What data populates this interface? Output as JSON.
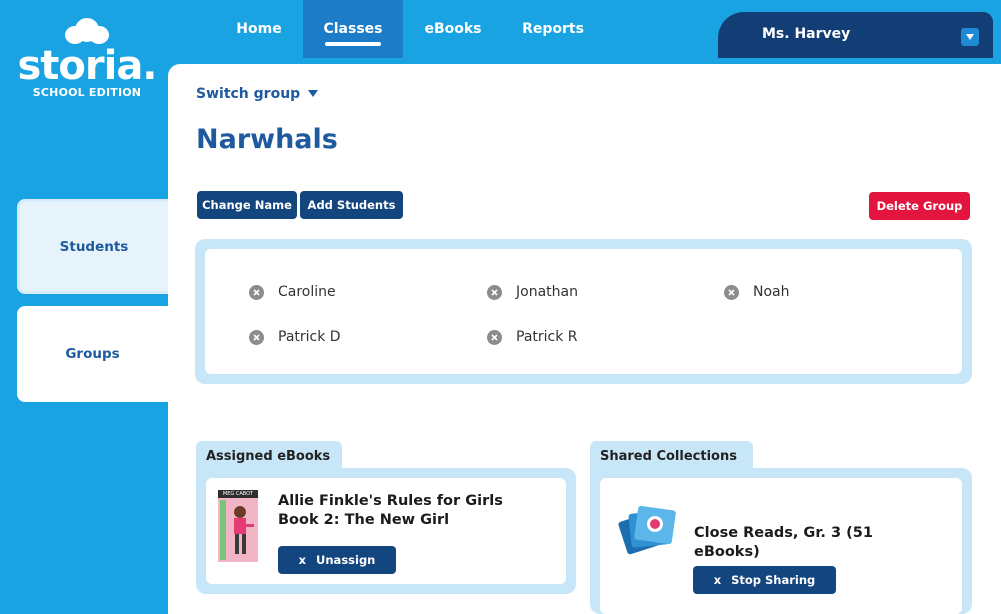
{
  "logo": {
    "brand": "storia.",
    "edition": "SCHOOL EDITION"
  },
  "nav": {
    "items": [
      "Home",
      "Classes",
      "eBooks",
      "Reports"
    ],
    "active": "Classes"
  },
  "user": {
    "name": "Ms. Harvey",
    "dropdown_icon": "chevron-down-icon"
  },
  "sidebar": {
    "items": [
      {
        "label": "Students",
        "selected": false
      },
      {
        "label": "Groups",
        "selected": true
      }
    ]
  },
  "group": {
    "switch_label": "Switch group",
    "name": "Narwhals",
    "buttons": {
      "change_name": "Change Name",
      "add_students": "Add Students",
      "delete_group": "Delete Group"
    },
    "students": [
      "Caroline",
      "Jonathan",
      "Noah",
      "Patrick D",
      "Patrick R"
    ]
  },
  "assigned": {
    "tab_label": "Assigned eBooks",
    "book": {
      "cover_author": "MEG CABOT",
      "title": "Allie Finkle's Rules for Girls Book 2: The New Girl",
      "button_icon": "x",
      "button_label": "Unassign"
    }
  },
  "shared": {
    "tab_label": "Shared Collections",
    "collection": {
      "title": "Close Reads, Gr. 3 (51 eBooks)",
      "button_icon": "x",
      "button_label": "Stop Sharing"
    }
  },
  "colors": {
    "background": "#1aa3e3",
    "nav_active": "#1d7cc8",
    "dark_button": "#13457f",
    "danger": "#e3153f",
    "panel": "#c7e6f8",
    "heading": "#1f5a9e"
  }
}
